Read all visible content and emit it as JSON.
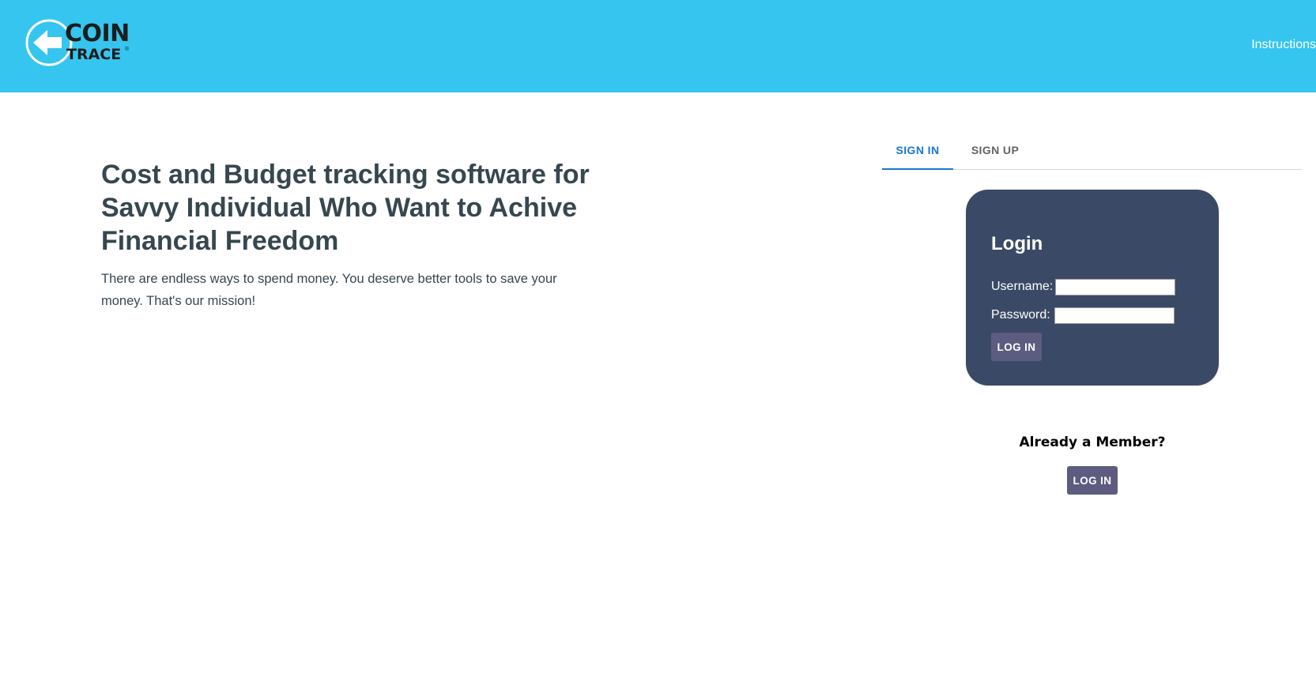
{
  "header": {
    "logo": {
      "line1": "COIN",
      "line2": "TRACE",
      "reg": "®"
    },
    "nav_instructions": "Instructions"
  },
  "hero": {
    "title": "Cost and Budget tracking software for Savvy Individual Who Want to Achive Financial Freedom",
    "subtitle": "There are endless ways to spend money. You deserve better tools to save your money. That's our mission!"
  },
  "tabs": [
    {
      "label": "SIGN IN",
      "active": true
    },
    {
      "label": "SIGN UP",
      "active": false
    }
  ],
  "login": {
    "title": "Login",
    "username_label": "Username:",
    "username_value": "",
    "password_label": "Password:",
    "password_value": "",
    "button_label": "LOG IN"
  },
  "member": {
    "text": "Already a Member?",
    "button_label": "LOG IN"
  },
  "colors": {
    "header_bg": "#36c5ee",
    "card_bg": "#3a4a66",
    "button_bg": "#5d5b80",
    "active_tab": "#1976d2",
    "heading_text": "#36474f"
  },
  "icons": {
    "logo_arrow": "arrow-left-icon"
  }
}
